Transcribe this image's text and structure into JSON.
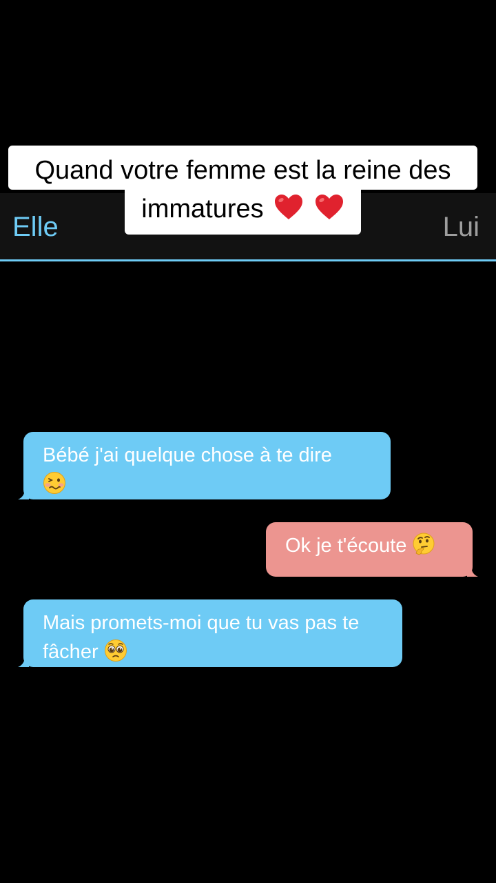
{
  "caption": {
    "line1": "Quand votre femme est la reine des",
    "line2": "immatures",
    "emojis": [
      "red-heart",
      "red-heart"
    ]
  },
  "header": {
    "left_name": "Elle",
    "right_name": "Lui"
  },
  "messages": [
    {
      "sender": "Elle",
      "text": "Bébé j'ai quelque chose à te dire",
      "emoji": "woozy-face"
    },
    {
      "sender": "Lui",
      "text": "Ok je t'écoute",
      "emoji": "thinking-face"
    },
    {
      "sender": "Elle",
      "text": "Mais promets-moi que tu vas pas te fâcher",
      "emoji": "pleading-face"
    }
  ],
  "colors": {
    "background": "#000000",
    "header_bg": "#121212",
    "accent_blue": "#6ecbf5",
    "left_bubble": "#6ecbf5",
    "right_bubble": "#ec9590",
    "right_name": "#9e9e9e",
    "heart": "#e0222e"
  }
}
